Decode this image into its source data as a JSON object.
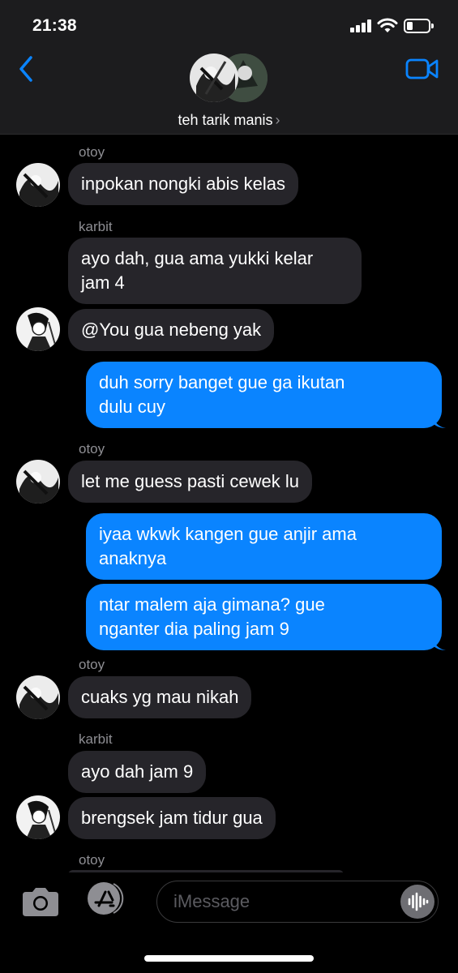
{
  "status_bar": {
    "time": "21:38"
  },
  "header": {
    "group_name": "teh tarik manis",
    "chevron": "›",
    "icons": {
      "back": "chevron-left-icon",
      "video": "video-camera-icon"
    },
    "accent_color": "#0a84ff"
  },
  "messages": [
    {
      "sender": "otoy",
      "text": "inpokan nongki abis kelas",
      "direction": "incoming"
    },
    {
      "sender": "karbit",
      "text": "ayo dah, gua ama yukki kelar jam 4",
      "direction": "incoming"
    },
    {
      "sender": "karbit",
      "text": "@You gua nebeng yak",
      "direction": "incoming"
    },
    {
      "sender": "You",
      "text": "duh sorry banget gue ga ikutan dulu cuy",
      "direction": "outgoing"
    },
    {
      "sender": "otoy",
      "text": "let me guess pasti cewek lu",
      "direction": "incoming"
    },
    {
      "sender": "You",
      "text": "iyaa wkwk kangen gue anjir ama anaknya",
      "direction": "outgoing"
    },
    {
      "sender": "You",
      "text": "ntar malem aja gimana? gue nganter dia paling jam 9",
      "direction": "outgoing"
    },
    {
      "sender": "otoy",
      "text": "cuaks yg mau nikah",
      "direction": "incoming"
    },
    {
      "sender": "karbit",
      "text": "ayo dah jam 9",
      "direction": "incoming"
    },
    {
      "sender": "karbit",
      "text": "brengsek jam tidur gua",
      "direction": "incoming"
    },
    {
      "sender": "otoy",
      "text": "",
      "direction": "incoming"
    }
  ],
  "sender_labels": {
    "otoy": "otoy",
    "karbit": "karbit"
  },
  "texts": {
    "m1": "inpokan nongki abis kelas",
    "m2a": "ayo dah, gua ama yukki kelar",
    "m2b": "jam 4",
    "m3": "@You gua nebeng yak",
    "m4a": "duh sorry banget gue ga ikutan",
    "m4b": "dulu cuy",
    "m5": "let me guess pasti cewek lu",
    "m6a": "iyaa wkwk kangen gue anjir ama",
    "m6b": "anaknya",
    "m7a": "ntar malem aja gimana? gue",
    "m7b": "nganter dia paling jam 9",
    "m8": "cuaks yg mau nikah",
    "m9": "ayo dah jam 9",
    "m10": "brengsek jam tidur gua"
  },
  "input_bar": {
    "placeholder": "iMessage",
    "icons": {
      "camera": "camera-icon",
      "apps": "app-store-icon",
      "voice": "waveform-icon"
    }
  },
  "colors": {
    "incoming_bubble": "#26252a",
    "outgoing_bubble": "#0a84ff",
    "background": "#000000",
    "header": "#1c1c1e"
  }
}
